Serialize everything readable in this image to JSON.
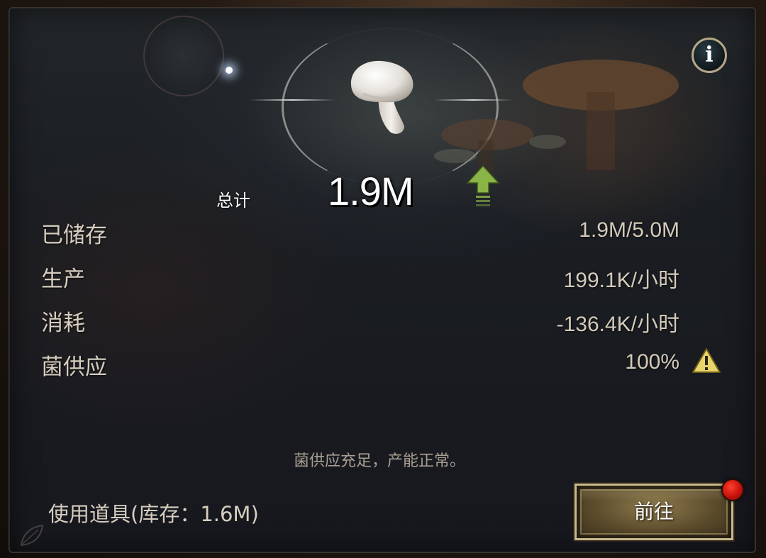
{
  "dialog": {
    "info_icon": "info-icon",
    "info_glyph": "i",
    "resource_icon": "mushroom-icon",
    "total": {
      "label": "总计",
      "value": "1.9M",
      "trend_icon": "up-arrow-icon"
    },
    "stats": [
      {
        "label": "已储存",
        "value": "1.9M/5.0M"
      },
      {
        "label": "生产",
        "value": "199.1K/小时"
      },
      {
        "label": "消耗",
        "value": "-136.4K/小时"
      },
      {
        "label": "菌供应",
        "value": "100%",
        "icon": "warning-icon"
      }
    ],
    "status_message": "菌供应充足，产能正常。",
    "item_usage": "使用道具(库存：1.6M)",
    "go_button": {
      "label": "前往",
      "has_notification": true
    }
  },
  "colors": {
    "label_text": "#d6cdbf",
    "button_gold": "#c9b98a",
    "arrow_green": "#8ab446",
    "warning_yellow": "#e8d46a",
    "notification_red": "#d41a10"
  }
}
